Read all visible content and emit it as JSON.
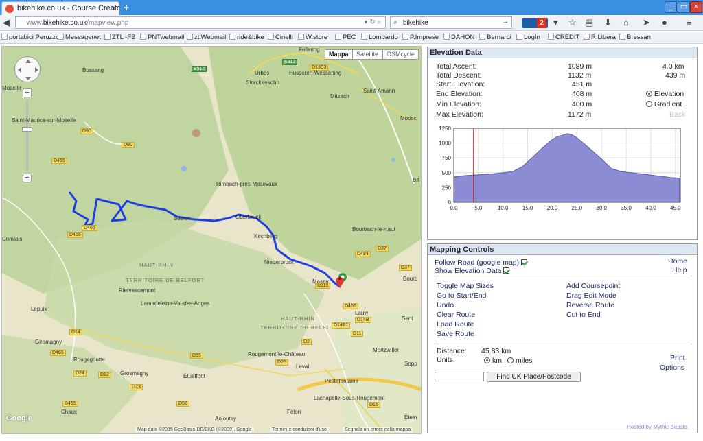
{
  "browser": {
    "tab_title": "bikehike.co.uk - Course Creator",
    "url_prefix": "www.",
    "url_domain": "bikehike.co.uk",
    "url_path": "/mapview.php",
    "search_value": "bikehike",
    "mail_count": "2"
  },
  "bookmarks": [
    "portabici Peruzzo",
    "Messagenet",
    "ZTL -FB",
    "PNTwebmail",
    "ztlWebmail",
    "ride&bike",
    "Cinelli",
    "W.store",
    "PEC",
    "Lombardo",
    "P.Imprese",
    "DAHON",
    "Bernardi",
    "LogIn",
    "CREDIT",
    "R.Libera",
    "Bressan"
  ],
  "map": {
    "type_tabs": [
      "Mappa",
      "Satellite",
      "OSMcycle"
    ],
    "active_type": "Mappa",
    "towns": [
      "Bussang",
      "Urbès",
      "Husseren-Wesserling",
      "Storckensohn",
      "Saint-Amarin",
      "Mitzach",
      "Saint-Maurice-sur-Moselle",
      "Moosc",
      "Rimbach-près-Masevaux",
      "Oberbruck",
      "Kirchberg",
      "Bourbach-le-Haut",
      "Niederbruck",
      "Masev",
      "Riervescemont",
      "Lamadeleine-Val-des-Anges",
      "Lauw",
      "Sent",
      "Lepuix",
      "Giromagny",
      "Rougegoutte",
      "Grosmagny",
      "Étueffont",
      "Rougemont-le-Château",
      "Leval",
      "Petitefontaine",
      "Mortzwiller",
      "Lachapelle-Sous-Rougemont",
      "Chaux",
      "Felon",
      "Anjoutey",
      "Bit",
      "Bourb",
      "Etein",
      "Sopp",
      "Fellering",
      "Sewen",
      "Moselle",
      "Comtois"
    ],
    "regions": [
      "HAUT-RHIN",
      "TERRITOIRE DE BELFORT",
      "HAUT-RHIN",
      "TERRITOIRE DE BELFORT"
    ],
    "roads": [
      "E512",
      "E512",
      "D13B3",
      "D90",
      "D90",
      "D465",
      "D465",
      "D465",
      "D484",
      "D37",
      "D37",
      "D466",
      "D14B",
      "D14B1",
      "D11",
      "D14",
      "D465",
      "D24",
      "D12",
      "D23",
      "D55",
      "D25",
      "D2",
      "D15",
      "D110",
      "D58",
      "D465"
    ],
    "attribution": "Map data ©2015 GeoBasis-DE/BKG (©2009), Google",
    "terms": "Termini e condizioni d'uso",
    "report": "Segnala un errore nella mappa",
    "google": "Google"
  },
  "elevation": {
    "title": "Elevation Data",
    "rows": [
      {
        "label": "Total Ascent:",
        "value": "1089 m"
      },
      {
        "label": "Total Descent:",
        "value": "1132 m"
      },
      {
        "label": "Start Elevation:",
        "value": "451 m"
      },
      {
        "label": "End Elevation:",
        "value": "408 m"
      },
      {
        "label": "Min Elevation:",
        "value": "400 m"
      },
      {
        "label": "Max Elevation:",
        "value": "1172 m"
      }
    ],
    "dist1": "4.0 km",
    "dist2": "439 m",
    "radio_elevation": "Elevation",
    "radio_gradient": "Gradient",
    "back": "Back",
    "y_ticks": [
      "0",
      "250",
      "500",
      "750",
      "1000",
      "1250"
    ],
    "x_ticks": [
      "0.0",
      "5.0",
      "10.0",
      "15.0",
      "20.0",
      "25.0",
      "30.0",
      "35.0",
      "40.0",
      "45.0"
    ],
    "marker_x": 4.0
  },
  "controls": {
    "title": "Mapping Controls",
    "follow_road": "Follow Road (google map)",
    "show_elevation": "Show Elevation Data",
    "home": "Home",
    "help": "Help",
    "left_links": [
      "Toggle Map Sizes",
      "Go to Start/End",
      "Undo",
      "Clear Route",
      "Load Route",
      "Save Route"
    ],
    "right_links": [
      "Add Coursepoint",
      "Drag Edit Mode",
      "Reverse Route",
      "Cut to End"
    ],
    "distance_label": "Distance:",
    "distance_value": "45.83  km",
    "units_label": "Units:",
    "unit_km": "km",
    "unit_miles": "miles",
    "print": "Print",
    "options": "Options",
    "find_button": "Find UK Place/Postcode",
    "footer": "Hosted by Mythic Beasts"
  },
  "colors": {
    "route": "#1f3fe0",
    "chart_fill": "#8c8cd4",
    "panel_header": "#dde6f3"
  },
  "chart_data": {
    "type": "area",
    "title": "",
    "xlabel": "",
    "ylabel": "",
    "xlim": [
      0,
      46
    ],
    "ylim": [
      0,
      1250
    ],
    "x": [
      0,
      2,
      4,
      6,
      8,
      10,
      12,
      14,
      16,
      18,
      20,
      21,
      22,
      23,
      24,
      25,
      26,
      28,
      30,
      32,
      34,
      36,
      38,
      40,
      42,
      44,
      45.83
    ],
    "values": [
      430,
      450,
      460,
      470,
      480,
      500,
      520,
      610,
      760,
      920,
      1060,
      1110,
      1130,
      1160,
      1140,
      1090,
      1020,
      880,
      730,
      570,
      520,
      500,
      480,
      460,
      440,
      420,
      408
    ]
  }
}
